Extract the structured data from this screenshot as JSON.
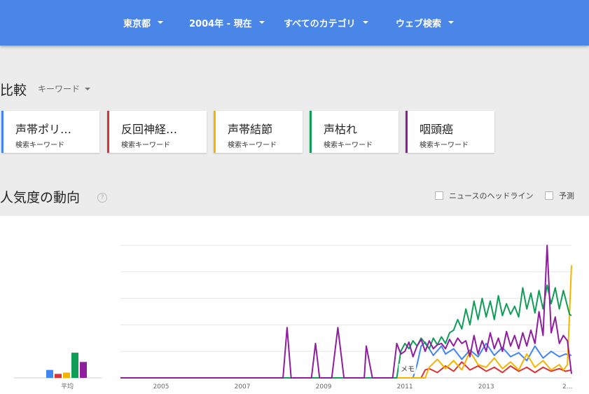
{
  "topbar": {
    "filters": [
      {
        "label": "東京都"
      },
      {
        "label": "2004年 - 現在"
      },
      {
        "label": "すべてのカテゴリ"
      },
      {
        "label": "ウェブ検索"
      }
    ]
  },
  "compare": {
    "title": "比較",
    "type_label": "キーワード",
    "terms": [
      {
        "name": "声帯ポリ…",
        "subtitle": "検索キーワード",
        "color": "#4285f4"
      },
      {
        "name": "反回神経…",
        "subtitle": "検索キーワード",
        "color": "#db3236"
      },
      {
        "name": "声帯結節",
        "subtitle": "検索キーワード",
        "color": "#f4b400"
      },
      {
        "name": "声枯れ",
        "subtitle": "検索キーワード",
        "color": "#0f9d58"
      },
      {
        "name": "咽頭癌",
        "subtitle": "検索キーワード",
        "color": "#8e1e9e"
      }
    ]
  },
  "interest": {
    "title": "人気度の動向",
    "help_symbol": "?",
    "checkboxes": {
      "news_headlines": "ニュースのヘッドライン",
      "forecast": "予測"
    }
  },
  "chart_data": {
    "type": "line",
    "average_label": "平均",
    "average_bars": [
      {
        "name": "声帯ポリ…",
        "value": 6
      },
      {
        "name": "反回神経…",
        "value": 3
      },
      {
        "name": "声帯結節",
        "value": 4
      },
      {
        "name": "声枯れ",
        "value": 19
      },
      {
        "name": "咽頭癌",
        "value": 12
      }
    ],
    "x_tick_labels": [
      "2005",
      "2007",
      "2009",
      "2011",
      "2013",
      "2..."
    ],
    "x_tick_years": [
      2005,
      2007,
      2009,
      2011,
      2013,
      2015
    ],
    "xlim": [
      2004,
      2015.1
    ],
    "ylim": [
      0,
      100
    ],
    "grid": true,
    "annotation": {
      "label": "メモ",
      "x": 2011.0
    },
    "series": [
      {
        "name": "声帯ポリ…",
        "color": "#4285f4",
        "points": [
          [
            2004,
            0
          ],
          [
            2011.2,
            0
          ],
          [
            2011.3,
            10
          ],
          [
            2011.4,
            24
          ],
          [
            2011.5,
            27
          ],
          [
            2011.7,
            17
          ],
          [
            2011.9,
            24
          ],
          [
            2012.0,
            18
          ],
          [
            2012.2,
            22
          ],
          [
            2012.4,
            14
          ],
          [
            2012.6,
            21
          ],
          [
            2012.8,
            16
          ],
          [
            2013.0,
            26
          ],
          [
            2013.2,
            17
          ],
          [
            2013.4,
            23
          ],
          [
            2013.6,
            16
          ],
          [
            2013.8,
            19
          ],
          [
            2014.0,
            13
          ],
          [
            2014.2,
            24
          ],
          [
            2014.4,
            15
          ],
          [
            2014.6,
            20
          ],
          [
            2014.8,
            16
          ],
          [
            2014.95,
            18
          ],
          [
            2015.1,
            17
          ]
        ]
      },
      {
        "name": "反回神経…",
        "color": "#db3236",
        "points": [
          [
            2004,
            0
          ],
          [
            2011.4,
            0
          ],
          [
            2011.5,
            6
          ],
          [
            2011.6,
            7
          ],
          [
            2011.8,
            4
          ],
          [
            2012.0,
            9
          ],
          [
            2012.2,
            5
          ],
          [
            2012.4,
            12
          ],
          [
            2012.6,
            6
          ],
          [
            2012.8,
            9
          ],
          [
            2013.0,
            5
          ],
          [
            2013.2,
            8
          ],
          [
            2013.4,
            4
          ],
          [
            2013.6,
            9
          ],
          [
            2013.8,
            5
          ],
          [
            2014.0,
            8
          ],
          [
            2014.2,
            4
          ],
          [
            2014.4,
            8
          ],
          [
            2014.6,
            5
          ],
          [
            2014.8,
            7
          ],
          [
            2014.95,
            5
          ],
          [
            2015.1,
            6
          ]
        ]
      },
      {
        "name": "声帯結節",
        "color": "#f4b400",
        "points": [
          [
            2004,
            0
          ],
          [
            2011.5,
            0
          ],
          [
            2011.6,
            8
          ],
          [
            2011.8,
            14
          ],
          [
            2012.0,
            7
          ],
          [
            2012.2,
            13
          ],
          [
            2012.4,
            6
          ],
          [
            2012.6,
            20
          ],
          [
            2012.8,
            10
          ],
          [
            2013.0,
            8
          ],
          [
            2013.2,
            15
          ],
          [
            2013.4,
            7
          ],
          [
            2013.6,
            12
          ],
          [
            2013.8,
            6
          ],
          [
            2014.0,
            18
          ],
          [
            2014.2,
            8
          ],
          [
            2014.4,
            13
          ],
          [
            2014.6,
            6
          ],
          [
            2014.8,
            10
          ],
          [
            2014.9,
            6
          ],
          [
            2015.0,
            10
          ],
          [
            2015.1,
            85
          ]
        ]
      },
      {
        "name": "声枯れ",
        "color": "#0f9d58",
        "points": [
          [
            2004,
            0
          ],
          [
            2010.8,
            0
          ],
          [
            2010.9,
            20
          ],
          [
            2011.0,
            26
          ],
          [
            2011.1,
            22
          ],
          [
            2011.2,
            28
          ],
          [
            2011.3,
            24
          ],
          [
            2011.4,
            30
          ],
          [
            2011.5,
            26
          ],
          [
            2011.6,
            22
          ],
          [
            2011.7,
            30
          ],
          [
            2011.8,
            25
          ],
          [
            2011.9,
            31
          ],
          [
            2012.0,
            26
          ],
          [
            2012.1,
            34
          ],
          [
            2012.2,
            36
          ],
          [
            2012.3,
            44
          ],
          [
            2012.4,
            37
          ],
          [
            2012.5,
            52
          ],
          [
            2012.6,
            40
          ],
          [
            2012.7,
            58
          ],
          [
            2012.8,
            44
          ],
          [
            2012.9,
            60
          ],
          [
            2013.0,
            46
          ],
          [
            2013.1,
            58
          ],
          [
            2013.2,
            44
          ],
          [
            2013.3,
            62
          ],
          [
            2013.4,
            47
          ],
          [
            2013.5,
            56
          ],
          [
            2013.6,
            48
          ],
          [
            2013.7,
            54
          ],
          [
            2013.8,
            46
          ],
          [
            2013.9,
            68
          ],
          [
            2014.0,
            52
          ],
          [
            2014.1,
            64
          ],
          [
            2014.2,
            49
          ],
          [
            2014.3,
            66
          ],
          [
            2014.4,
            52
          ],
          [
            2014.5,
            70
          ],
          [
            2014.6,
            56
          ],
          [
            2014.7,
            68
          ],
          [
            2014.8,
            52
          ],
          [
            2014.9,
            66
          ],
          [
            2015.0,
            54
          ],
          [
            2015.05,
            48
          ],
          [
            2015.1,
            47
          ]
        ]
      },
      {
        "name": "咽頭癌",
        "color": "#8e1e9e",
        "points": [
          [
            2004,
            0
          ],
          [
            2008.0,
            0
          ],
          [
            2008.1,
            38
          ],
          [
            2008.2,
            0
          ],
          [
            2008.7,
            0
          ],
          [
            2008.8,
            26
          ],
          [
            2008.9,
            0
          ],
          [
            2009.2,
            0
          ],
          [
            2009.35,
            38
          ],
          [
            2009.5,
            0
          ],
          [
            2010.0,
            0
          ],
          [
            2010.05,
            24
          ],
          [
            2010.2,
            0
          ],
          [
            2010.7,
            0
          ],
          [
            2010.8,
            26
          ],
          [
            2010.9,
            18
          ],
          [
            2011.0,
            20
          ],
          [
            2011.1,
            27
          ],
          [
            2011.2,
            16
          ],
          [
            2011.3,
            24
          ],
          [
            2011.4,
            29
          ],
          [
            2011.5,
            20
          ],
          [
            2011.6,
            28
          ],
          [
            2011.7,
            22
          ],
          [
            2011.8,
            25
          ],
          [
            2011.9,
            26
          ],
          [
            2012.0,
            22
          ],
          [
            2012.1,
            29
          ],
          [
            2012.2,
            24
          ],
          [
            2012.3,
            30
          ],
          [
            2012.4,
            26
          ],
          [
            2012.5,
            28
          ],
          [
            2012.6,
            16
          ],
          [
            2012.7,
            32
          ],
          [
            2012.8,
            18
          ],
          [
            2012.9,
            28
          ],
          [
            2013.0,
            20
          ],
          [
            2013.1,
            34
          ],
          [
            2013.2,
            22
          ],
          [
            2013.3,
            30
          ],
          [
            2013.4,
            20
          ],
          [
            2013.5,
            35
          ],
          [
            2013.6,
            24
          ],
          [
            2013.7,
            32
          ],
          [
            2013.8,
            22
          ],
          [
            2013.9,
            34
          ],
          [
            2014.0,
            24
          ],
          [
            2014.1,
            36
          ],
          [
            2014.2,
            26
          ],
          [
            2014.3,
            50
          ],
          [
            2014.4,
            32
          ],
          [
            2014.5,
            100
          ],
          [
            2014.6,
            34
          ],
          [
            2014.7,
            46
          ],
          [
            2014.8,
            26
          ],
          [
            2014.9,
            32
          ],
          [
            2015.0,
            28
          ],
          [
            2015.1,
            3
          ]
        ]
      }
    ]
  }
}
